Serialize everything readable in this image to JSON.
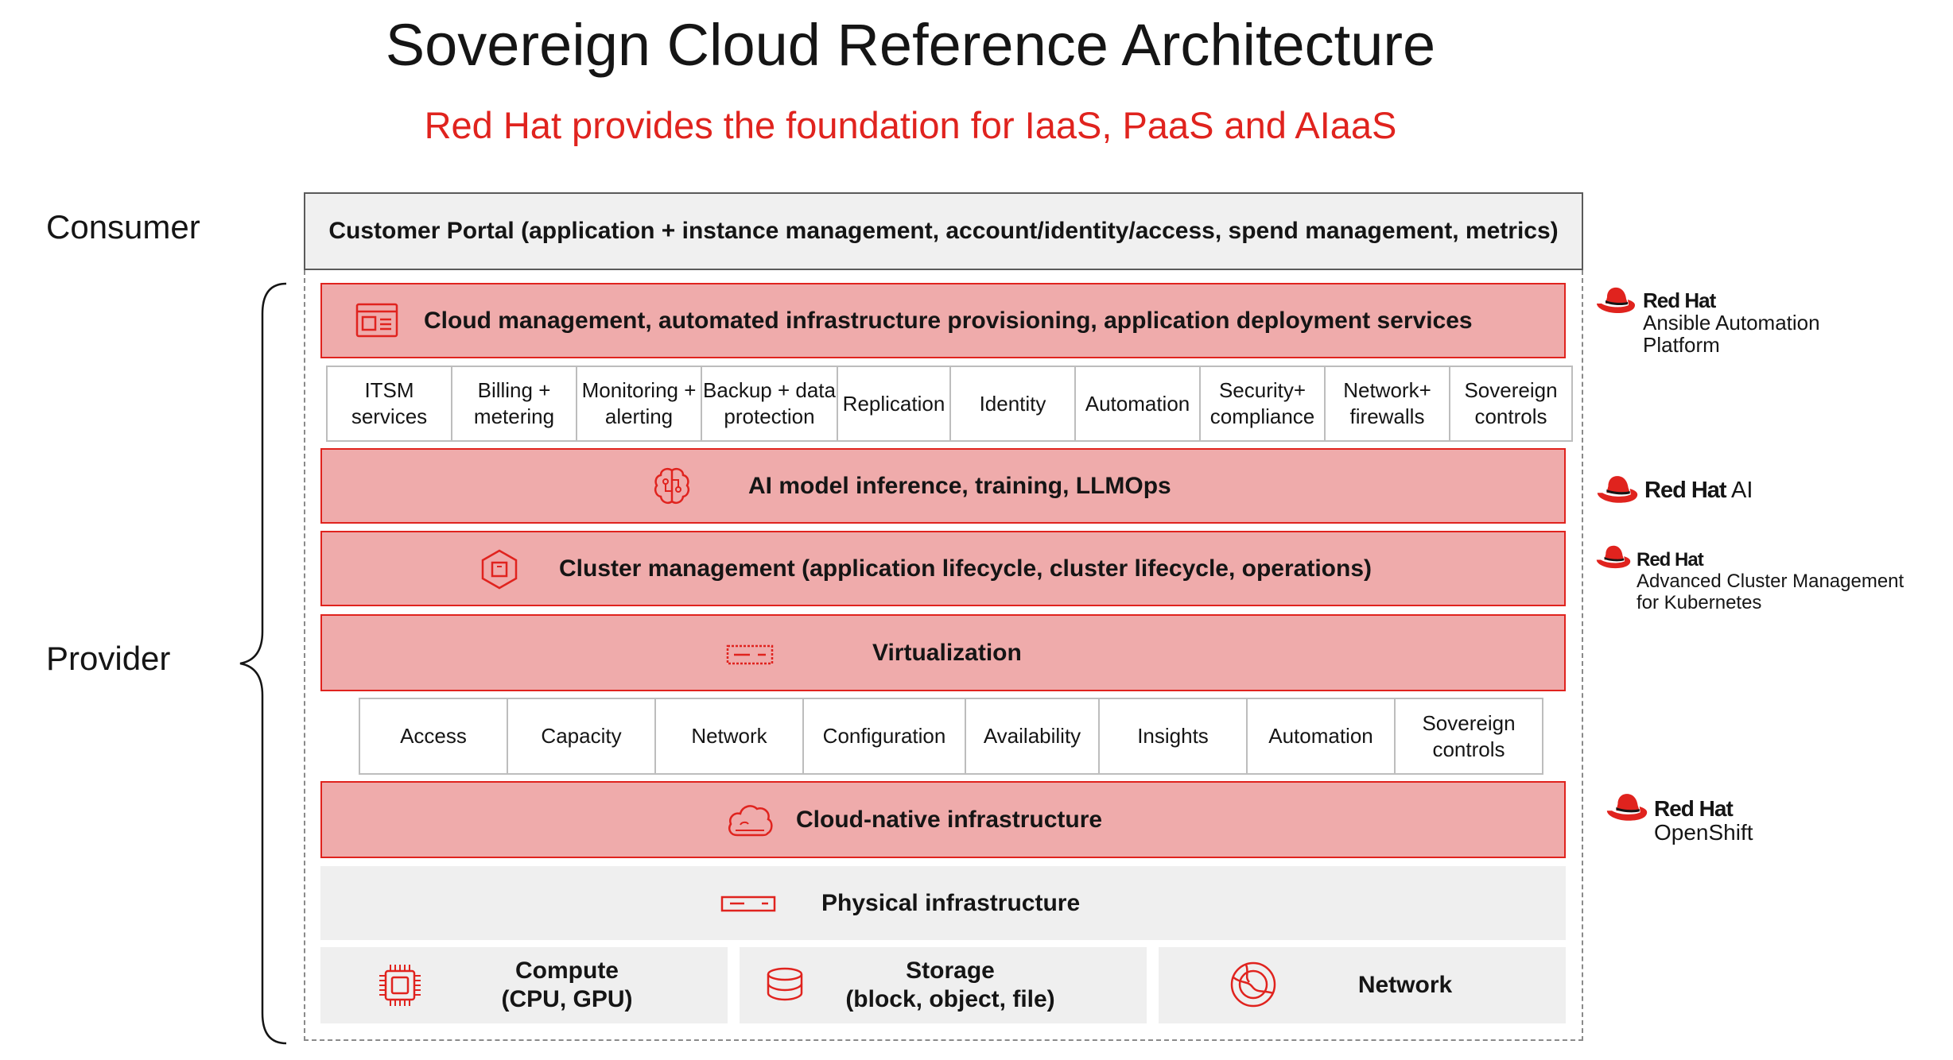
{
  "title": "Sovereign Cloud Reference Architecture",
  "subtitle": "Red Hat provides the foundation for IaaS, PaaS and AIaaS",
  "labels": {
    "consumer": "Consumer",
    "provider": "Provider"
  },
  "portal": "Customer Portal (application + instance management, account/identity/access, spend management, metrics)",
  "bands": {
    "cloud_management": "Cloud management, automated infrastructure provisioning, application deployment services",
    "ai_model": "AI model inference, training, LLMOps",
    "cluster_management": "Cluster management (application lifecycle, cluster lifecycle, operations)",
    "virtualization": "Virtualization",
    "cloud_native": "Cloud-native infrastructure",
    "physical": "Physical infrastructure"
  },
  "services_row_1": [
    {
      "line1": "ITSM",
      "line2": "services"
    },
    {
      "line1": "Billing +",
      "line2": "metering"
    },
    {
      "line1": "Monitoring +",
      "line2": "alerting"
    },
    {
      "line1": "Backup + data",
      "line2": "protection"
    },
    {
      "line1": "Replication",
      "line2": ""
    },
    {
      "line1": "Identity",
      "line2": ""
    },
    {
      "line1": "Automation",
      "line2": ""
    },
    {
      "line1": "Security+",
      "line2": "compliance"
    },
    {
      "line1": "Network+",
      "line2": "firewalls"
    },
    {
      "line1": "Sovereign",
      "line2": "controls"
    }
  ],
  "services_row_2": [
    {
      "line1": "Access",
      "line2": ""
    },
    {
      "line1": "Capacity",
      "line2": ""
    },
    {
      "line1": "Network",
      "line2": ""
    },
    {
      "line1": "Configuration",
      "line2": ""
    },
    {
      "line1": "Availability",
      "line2": ""
    },
    {
      "line1": "Insights",
      "line2": ""
    },
    {
      "line1": "Automation",
      "line2": ""
    },
    {
      "line1": "Sovereign",
      "line2": "controls"
    }
  ],
  "physical_boxes": {
    "compute": {
      "line1": "Compute",
      "line2": "(CPU, GPU)"
    },
    "storage": {
      "line1": "Storage",
      "line2": "(block, object, file)"
    },
    "network": {
      "line1": "Network"
    }
  },
  "products": {
    "ansible": {
      "brand": "Red Hat",
      "line1": "Ansible Automation",
      "line2": "Platform"
    },
    "ai": {
      "brand": "Red Hat",
      "suffix": "AI"
    },
    "acm": {
      "brand": "Red Hat",
      "line1": "Advanced Cluster Management",
      "line2": "for Kubernetes"
    },
    "openshift": {
      "brand": "Red Hat",
      "line1": "OpenShift"
    }
  },
  "colors": {
    "accent": "#e0231e",
    "band_fill": "#efabab",
    "gray_fill": "#efefef"
  },
  "icons": [
    "browser-window-icon",
    "brain-icon",
    "hexagon-cube-icon",
    "server-rack-icon",
    "cloud-icon",
    "server-icon",
    "cpu-chip-icon",
    "database-icon",
    "globe-icon",
    "red-hat-fedora-icon"
  ]
}
